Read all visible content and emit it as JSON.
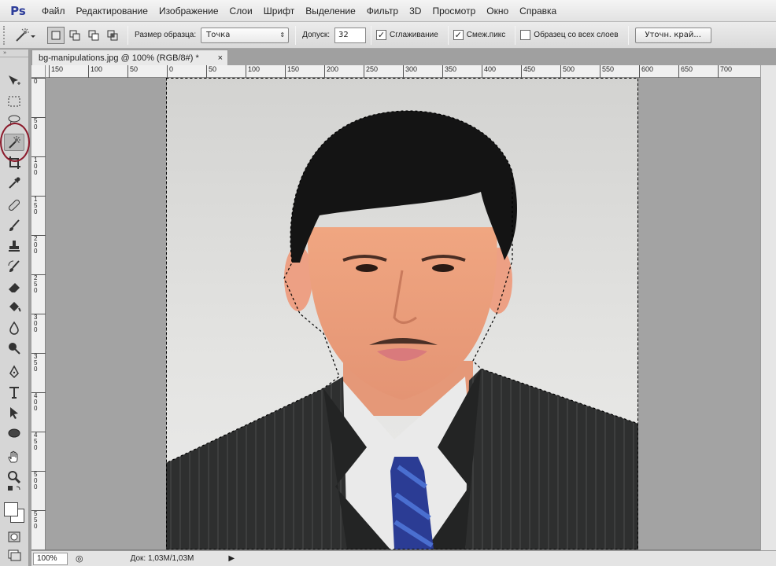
{
  "app": {
    "logo": "Ps"
  },
  "menu": [
    "Файл",
    "Редактирование",
    "Изображение",
    "Слои",
    "Шрифт",
    "Выделение",
    "Фильтр",
    "3D",
    "Просмотр",
    "Окно",
    "Справка"
  ],
  "options": {
    "sample_size_label": "Размер образца:",
    "sample_size_value": "Точка",
    "tolerance_label": "Допуск:",
    "tolerance_value": "32",
    "antialias_label": "Сглаживание",
    "antialias_checked": true,
    "contiguous_label": "Смеж.пикс",
    "contiguous_checked": true,
    "sample_all_label": "Образец со всех слоев",
    "sample_all_checked": false,
    "refine_edge_label": "Уточн. край..."
  },
  "document": {
    "tab_title": "bg-manipulations.jpg @ 100% (RGB/8#) *",
    "close_glyph": "×"
  },
  "rulers": {
    "h_labels": [
      "150",
      "100",
      "50",
      "0",
      "50",
      "100",
      "150",
      "200",
      "250",
      "300",
      "350",
      "400",
      "450",
      "500",
      "550",
      "600",
      "650",
      "700"
    ],
    "v_labels": [
      "0",
      "5 0",
      "1 0 0",
      "1 5 0",
      "2 0 0",
      "2 5 0",
      "3 0 0",
      "3 5 0",
      "4 0 0",
      "4 5 0",
      "5 0 0",
      "5 5 0"
    ]
  },
  "status": {
    "zoom": "100%",
    "doc_info": "Док: 1,03M/1,03M"
  },
  "toolbox": {
    "header": "»",
    "tools": [
      "move-tool-icon",
      "marquee-tool-icon",
      "lasso-tool-icon",
      "magic-wand-tool-icon",
      "crop-tool-icon",
      "eyedropper-tool-icon",
      "healing-brush-icon",
      "brush-tool-icon",
      "clone-stamp-icon",
      "history-brush-icon",
      "eraser-tool-icon",
      "paint-bucket-icon",
      "blur-tool-icon",
      "dodge-tool-icon",
      "pen-tool-icon",
      "type-tool-icon",
      "path-selection-icon",
      "ellipse-tool-icon",
      "hand-tool-icon",
      "zoom-tool-icon"
    ],
    "active_tool": "magic-wand-tool-icon"
  },
  "colors": {
    "highlight_ring": "#8b1a2b",
    "ps_logo": "#2d3d9a"
  }
}
